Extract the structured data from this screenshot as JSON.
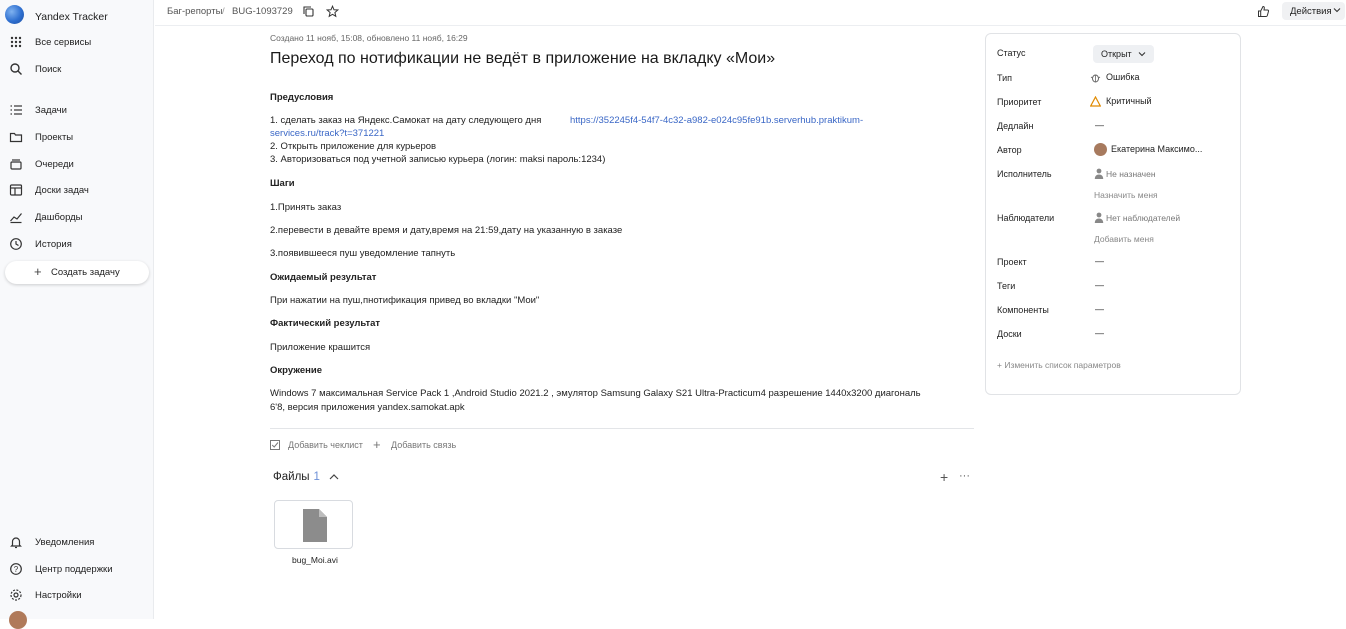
{
  "sidebar": {
    "brand": "Yandex Tracker",
    "items_top": [
      {
        "label": "Все сервисы",
        "icon": "grid-icon"
      },
      {
        "label": "Поиск",
        "icon": "search-icon"
      }
    ],
    "items_main": [
      {
        "label": "Задачи",
        "icon": "tasks-icon"
      },
      {
        "label": "Проекты",
        "icon": "folder-icon"
      },
      {
        "label": "Очереди",
        "icon": "queues-icon"
      },
      {
        "label": "Доски задач",
        "icon": "board-icon"
      },
      {
        "label": "Дашборды",
        "icon": "chart-icon"
      },
      {
        "label": "История",
        "icon": "history-icon"
      }
    ],
    "create_label": "Создать задачу",
    "items_bottom": [
      {
        "label": "Уведомления",
        "icon": "bell-icon"
      },
      {
        "label": "Центр поддержки",
        "icon": "help-icon"
      },
      {
        "label": "Настройки",
        "icon": "gear-icon"
      }
    ]
  },
  "topbar": {
    "breadcrumb_queue": "Баг-репорты",
    "breadcrumb_sep": "/",
    "issue_key": "BUG-1093729",
    "actions_label": "Действия"
  },
  "issue": {
    "meta": "Создано 11 нояб, 15:08, обновлено 11 нояб, 16:29",
    "title": "Переход по нотификации не ведёт в приложение на вкладку «Мои»",
    "preconditions_heading": "Предусловия",
    "pre1": "1. сделать заказ на Яндекс.Самокат на дату следующего дня",
    "pre1_link_a": "https://352245f4-54f7-4c32-a982-e024c95fe91b.serverhub.praktikum-",
    "pre1_link_b": "services.ru/track?t=371221",
    "pre2": "2. Открыть приложение для курьеров",
    "pre3": "3. Авторизоваться под учетной записью курьера (логин: maksi пароль:1234)",
    "steps_heading": "Шаги",
    "step1": "1.Принять заказ",
    "step2": "2.перевести в девайте время и дату,время на 21:59,дату на указанную в заказе",
    "step3": "3.появившееся пуш уведомление тапнуть",
    "expected_heading": "Ожидаемый результат",
    "expected": "При нажатии на пуш,пнотификация привед во вкладки \"Мои\"",
    "actual_heading": "Фактический результат",
    "actual": "Приложение крашится",
    "env_heading": "Окружение",
    "env1": "Windows 7 максимальная Service Pack 1 ,Android Studio 2021.2 , эмулятор Samsung Galaxy S21 Ultra-Practicum4 разрешение 1440x3200 диагональ",
    "env2": "6'8, версия приложения yandex.samokat.apk",
    "add_checklist": "Добавить чеклист",
    "add_link": "Добавить связь",
    "files_label": "Файлы",
    "files_count": "1",
    "file_name": "bug_Moi.avi"
  },
  "fields": {
    "status_label": "Статус",
    "status_value": "Открыт",
    "type_label": "Тип",
    "type_value": "Ошибка",
    "priority_label": "Приоритет",
    "priority_value": "Критичный",
    "deadline_label": "Дедлайн",
    "deadline_value": "—",
    "author_label": "Автор",
    "author_value": "Екатерина Максимо...",
    "assignee_label": "Исполнитель",
    "assignee_value": "Не назначен",
    "assign_me": "Назначить меня",
    "followers_label": "Наблюдатели",
    "followers_value": "Нет наблюдателей",
    "add_me": "Добавить меня",
    "project_label": "Проект",
    "project_value": "—",
    "tags_label": "Теги",
    "tags_value": "—",
    "components_label": "Компоненты",
    "components_value": "—",
    "boards_label": "Доски",
    "boards_value": "—",
    "edit_params": "Изменить список параметров"
  },
  "colors": {
    "link": "#3a67c6",
    "priority_warning": "#e08a00",
    "sidebar_bg": "#f8f9fb"
  }
}
